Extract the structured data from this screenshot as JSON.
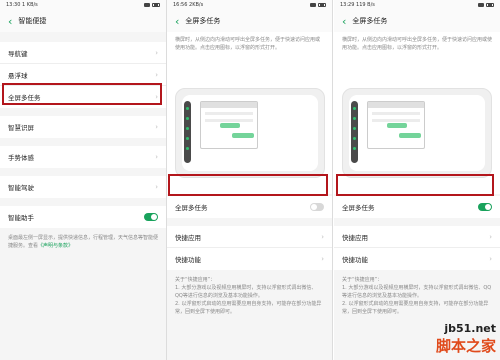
{
  "panel1": {
    "status_time": "13:30",
    "status_speed": "1 KB/s",
    "title": "智能便捷",
    "menu": [
      "导航键",
      "悬浮球",
      "全屏多任务",
      "智慧识屏",
      "手势体感",
      "智能驾驶"
    ],
    "assistant_label": "智能助手",
    "footnote": "桌面最左侧一屏显示，提供快递信息，行程管理，天气信息等智能便捷服务。查看",
    "footnote_link": "《声明与条款》"
  },
  "panel2": {
    "status_time": "16:56",
    "status_speed": "2KB/s",
    "title": "全屏多任务",
    "description": "横屏时，从侧边向内滑动可呼出全屏多任务，便于快速访问应用或使用功能。点击应用图标，以浮窗的形式打开。",
    "toggle_label": "全屏多任务",
    "toggle_on": false,
    "items": [
      "快捷应用",
      "快捷功能"
    ],
    "notes_title": "关于“快捷应用”：",
    "notes": [
      "1. 大部分游戏以及视频应用横屏时，支持以浮窗形式调出微信、QQ等进行信息的浏览及基本功能操作。",
      "2. 以浮窗形式启动的应用需要应用自身支持，可能存在部分功能异常，回到全屏下使用即可。"
    ]
  },
  "panel3": {
    "status_time": "13:29",
    "status_speed": "119 B/s",
    "title": "全屏多任务",
    "description": "横屏时，从侧边向内滑动可呼出全屏多任务，便于快速访问应用或使用功能。点击应用图标，以浮窗的形式打开。",
    "toggle_label": "全屏多任务",
    "toggle_on": true,
    "items": [
      "快捷应用",
      "快捷功能"
    ],
    "notes_title": "关于“快捷应用”：",
    "notes": [
      "1. 大部分游戏以及视频应用横屏时，支持以浮窗形式调出微信、QQ等进行信息的浏览及基本功能操作。",
      "2. 以浮窗形式启动的应用需要应用自身支持，可能存在部分功能异常，回到全屏下使用即可。"
    ]
  },
  "watermark": {
    "line1": "jb51.net",
    "line2": "脚本之家"
  },
  "colors": {
    "accent": "#19a25c",
    "highlight": "#b3161c",
    "watermark_red": "#e04a1b"
  }
}
